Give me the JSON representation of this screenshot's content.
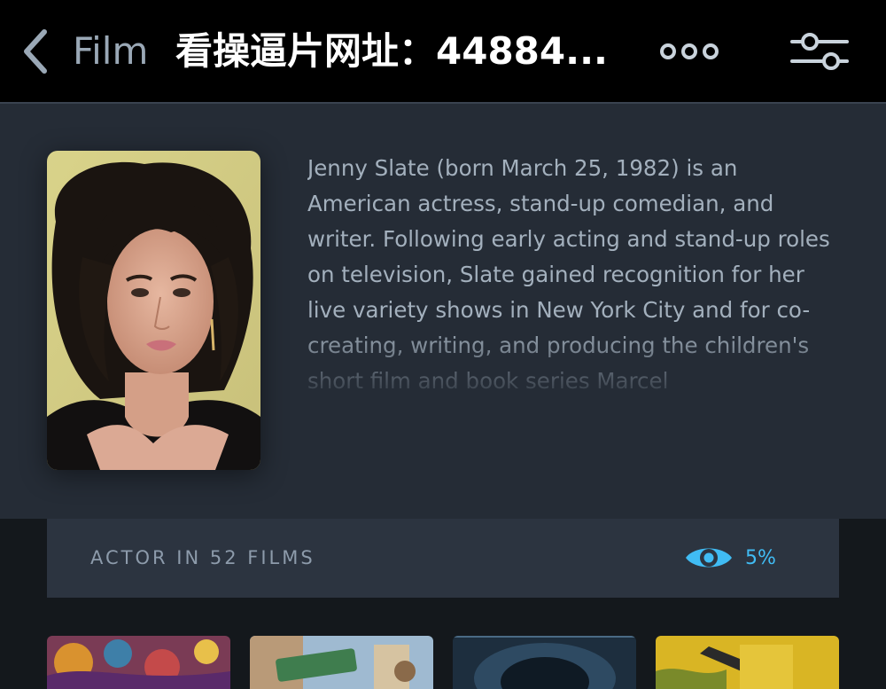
{
  "nav": {
    "back_label": "Film",
    "title": "看操逼片网址：44884...",
    "icons": {
      "back": "chevron-left-icon",
      "more": "more-dots-icon",
      "filter": "filter-sliders-icon"
    }
  },
  "actor": {
    "bio": "Jenny Slate (born March 25, 1982) is an American actress, stand-up comedian, and writer. Following early acting and stand-up roles on television, Slate gained recognition for her live variety shows in New York City and for co-creating, writing, and producing the children's short film and book series Marcel"
  },
  "stats": {
    "films_label": "ACTOR IN 52 FILMS",
    "watched_percent": "5%",
    "watched_icon": "eye-icon"
  },
  "colors": {
    "nav_background": "#000000",
    "hero_background": "#252c36",
    "stats_background": "#2c3440",
    "page_background": "#14181c",
    "accent": "#40bcf4",
    "body_text": "#a3b0bd"
  }
}
